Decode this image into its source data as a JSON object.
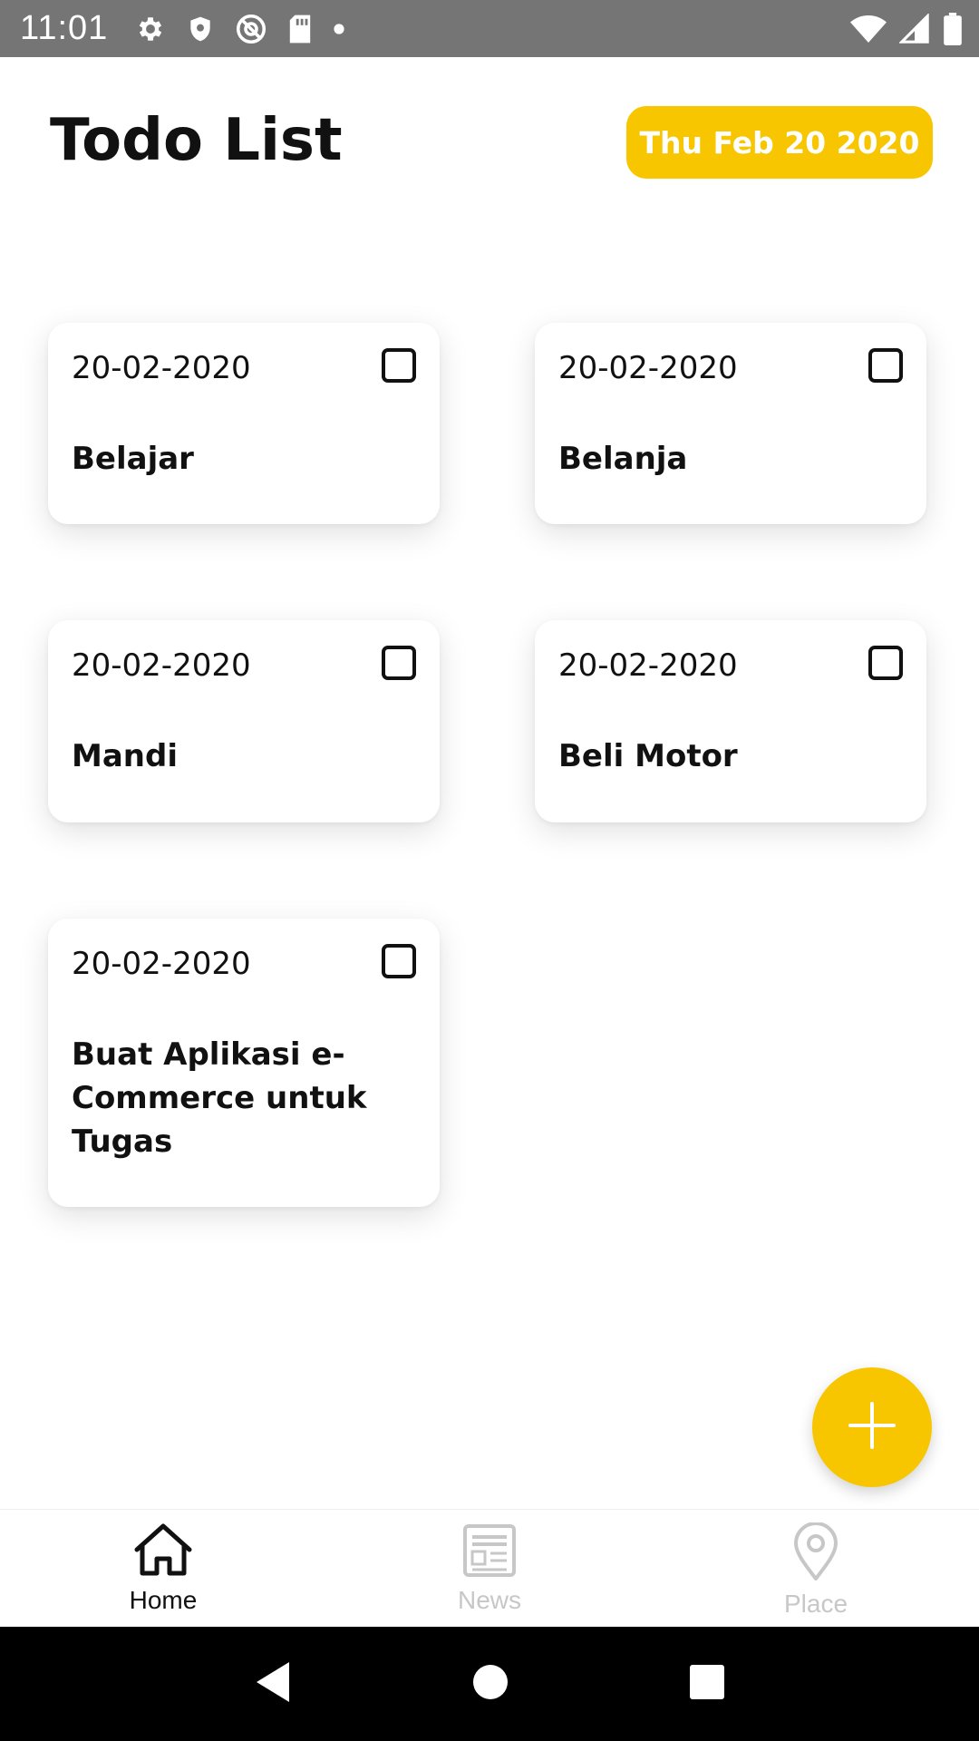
{
  "status_bar": {
    "time": "11:01",
    "left_icons": [
      "settings-icon",
      "shield-icon",
      "at-sign-icon",
      "sd-card-icon",
      "dot-icon"
    ],
    "right_icons": [
      "wifi-icon",
      "signal-icon",
      "battery-icon"
    ]
  },
  "header": {
    "title": "Todo List",
    "date": "Thu Feb 20 2020"
  },
  "todos": [
    {
      "date": "20-02-2020",
      "title": "Belajar",
      "checked": false
    },
    {
      "date": "20-02-2020",
      "title": "Belanja",
      "checked": false
    },
    {
      "date": "20-02-2020",
      "title": "Mandi",
      "checked": false
    },
    {
      "date": "20-02-2020",
      "title": "Beli Motor",
      "checked": false
    },
    {
      "date": "20-02-2020",
      "title": "Buat Aplikasi e-Commerce untuk Tugas",
      "checked": false
    }
  ],
  "fab": {
    "icon": "plus-icon"
  },
  "bottom_nav": {
    "items": [
      {
        "label": "Home",
        "icon": "home-icon",
        "active": true
      },
      {
        "label": "News",
        "icon": "news-icon",
        "active": false
      },
      {
        "label": "Place",
        "icon": "location-pin-icon",
        "active": false
      }
    ]
  },
  "system_nav": [
    "back-icon",
    "home-circle-icon",
    "recents-icon"
  ],
  "colors": {
    "accent": "#F7C600",
    "status_bar": "#757575",
    "text": "#111111",
    "inactive": "#C7C7C7"
  }
}
